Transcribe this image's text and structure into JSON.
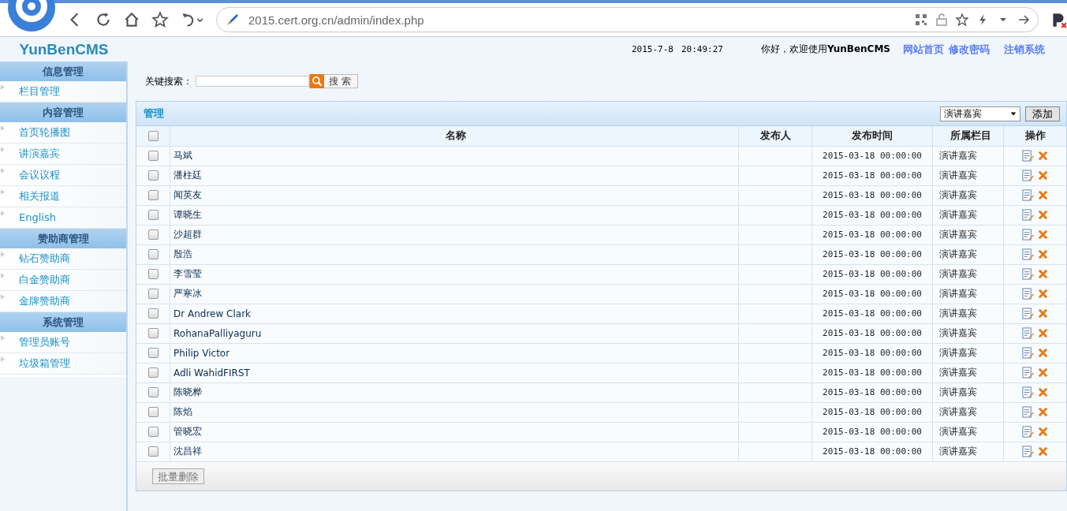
{
  "browser": {
    "address": "2015.cert.org.cn/admin/index.php"
  },
  "header": {
    "logo": "YunBenCMS",
    "date": "2015-7-8",
    "time": "20:49:27",
    "welcome": "你好，欢迎使用**YunBenCMS**",
    "links": [
      "网站首页",
      "修改密码",
      "注销系统"
    ]
  },
  "sidebar": [
    {
      "title": "信息管理",
      "items": [
        "栏目管理"
      ]
    },
    {
      "title": "内容管理",
      "items": [
        "首页轮播图",
        "讲演嘉宾",
        "会议议程",
        "相关报道",
        "English"
      ]
    },
    {
      "title": "赞助商管理",
      "items": [
        "钻石赞助商",
        "白金赞助商",
        "金牌赞助商"
      ]
    },
    {
      "title": "系统管理",
      "items": [
        "管理员账号",
        "垃圾箱管理"
      ]
    }
  ],
  "search": {
    "label": "关键搜索：",
    "button": "搜 索"
  },
  "panel": {
    "title": "管理",
    "category": "演讲嘉宾",
    "add_button": "添加",
    "select_all_checked": false,
    "columns": [
      "名称",
      "发布人",
      "发布时间",
      "所属栏目",
      "操作"
    ],
    "rows": [
      {
        "checked": false,
        "name": "马斌",
        "time": "2015-03-18 00:00:00",
        "column": "演讲嘉宾"
      },
      {
        "checked": false,
        "name": "潘柱廷",
        "time": "2015-03-18 00:00:00",
        "column": "演讲嘉宾"
      },
      {
        "checked": false,
        "name": "闻英友",
        "time": "2015-03-18 00:00:00",
        "column": "演讲嘉宾"
      },
      {
        "checked": false,
        "name": "谭晓生",
        "time": "2015-03-18 00:00:00",
        "column": "演讲嘉宾"
      },
      {
        "checked": false,
        "name": "沙超群",
        "time": "2015-03-18 00:00:00",
        "column": "演讲嘉宾"
      },
      {
        "checked": false,
        "name": "殷浩",
        "time": "2015-03-18 00:00:00",
        "column": "演讲嘉宾"
      },
      {
        "checked": false,
        "name": "李雪莹",
        "time": "2015-03-18 00:00:00",
        "column": "演讲嘉宾"
      },
      {
        "checked": false,
        "name": "严寒冰",
        "time": "2015-03-18 00:00:00",
        "column": "演讲嘉宾"
      },
      {
        "checked": false,
        "name": "Dr Andrew Clark",
        "time": "2015-03-18 00:00:00",
        "column": "演讲嘉宾"
      },
      {
        "checked": false,
        "name": "RohanaPalliyaguru",
        "time": "2015-03-18 00:00:00",
        "column": "演讲嘉宾"
      },
      {
        "checked": false,
        "name": "Philip Victor",
        "time": "2015-03-18 00:00:00",
        "column": "演讲嘉宾"
      },
      {
        "checked": false,
        "name": "Adli WahidFIRST",
        "time": "2015-03-18 00:00:00",
        "column": "演讲嘉宾"
      },
      {
        "checked": false,
        "name": "陈晓桦",
        "time": "2015-03-18 00:00:00",
        "column": "演讲嘉宾"
      },
      {
        "checked": false,
        "name": "陈焰",
        "time": "2015-03-18 00:00:00",
        "column": "演讲嘉宾"
      },
      {
        "checked": false,
        "name": "管晓宏",
        "time": "2015-03-18 00:00:00",
        "column": "演讲嘉宾"
      },
      {
        "checked": false,
        "name": "沈昌祥",
        "time": "2015-03-18 00:00:00",
        "column": "演讲嘉宾"
      }
    ],
    "batch_delete": "批量删除"
  }
}
